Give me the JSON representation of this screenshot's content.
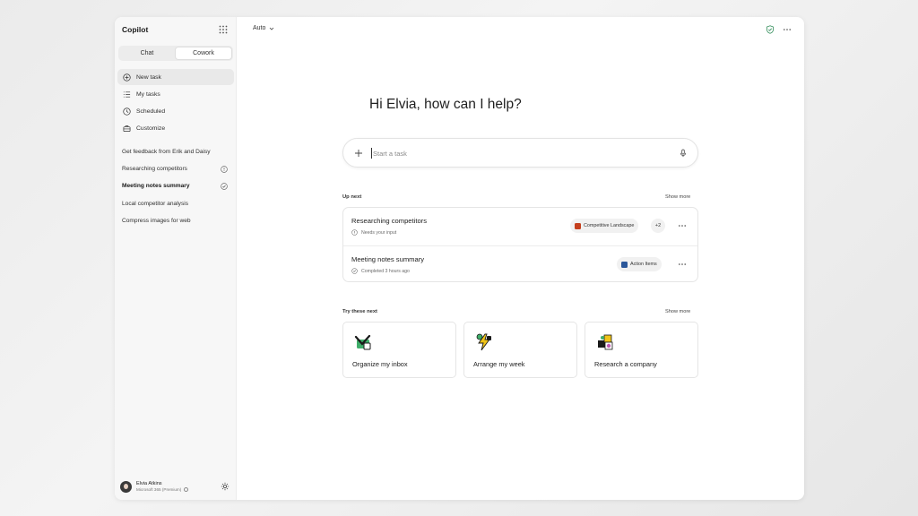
{
  "sidebar": {
    "brand": "Copilot",
    "mode_tabs": [
      {
        "label": "Chat",
        "active": false
      },
      {
        "label": "Cowork",
        "active": true
      }
    ],
    "nav": [
      {
        "label": "New task",
        "icon": "plus-circle-icon",
        "active": true
      },
      {
        "label": "My tasks",
        "icon": "list-icon",
        "active": false
      },
      {
        "label": "Scheduled",
        "icon": "clock-icon",
        "active": false
      },
      {
        "label": "Customize",
        "icon": "briefcase-icon",
        "active": false
      }
    ],
    "recents": [
      {
        "label": "Get feedback from Erik and Daisy",
        "status_icon": ""
      },
      {
        "label": "Researching competitors",
        "status_icon": "alert-circle-icon"
      },
      {
        "label": "Meeting notes summary",
        "status_icon": "check-circle-icon",
        "bold": true
      },
      {
        "label": "Local competitor analysis",
        "status_icon": ""
      },
      {
        "label": "Compress images for web",
        "status_icon": ""
      }
    ],
    "user": {
      "name": "Elvia Atkins",
      "plan": "Microsoft 365 (Premium)"
    }
  },
  "main": {
    "model": "Auto",
    "greeting": "Hi Elvia, how can I help?",
    "composer": {
      "placeholder": "Start a task"
    },
    "up_next": {
      "title": "Up next",
      "show_more": "Show more",
      "tasks": [
        {
          "title": "Researching competitors",
          "status": "Needs your input",
          "status_icon": "alert-circle-icon",
          "attachment": "Competitive Landscape",
          "attachment_icon": "powerpoint-file-icon",
          "attachment_color": "#c43e1c",
          "extra_count": "+2"
        },
        {
          "title": "Meeting notes summary",
          "status": "Completed 3 hours ago",
          "status_icon": "check-circle-icon",
          "attachment": "Action Items",
          "attachment_icon": "word-file-icon",
          "attachment_color": "#2b579a"
        }
      ]
    },
    "try_next": {
      "title": "Try these next",
      "show_more": "Show more",
      "cards": [
        {
          "label": "Organize my inbox",
          "icon": "inbox-illustration-icon"
        },
        {
          "label": "Arrange my week",
          "icon": "lightning-illustration-icon"
        },
        {
          "label": "Research a company",
          "icon": "cubes-illustration-icon"
        }
      ]
    }
  },
  "colors": {
    "accent_green": "#2e8b57",
    "sidebar_bg": "#f7f7f7",
    "active_item": "#e9e9e9"
  }
}
